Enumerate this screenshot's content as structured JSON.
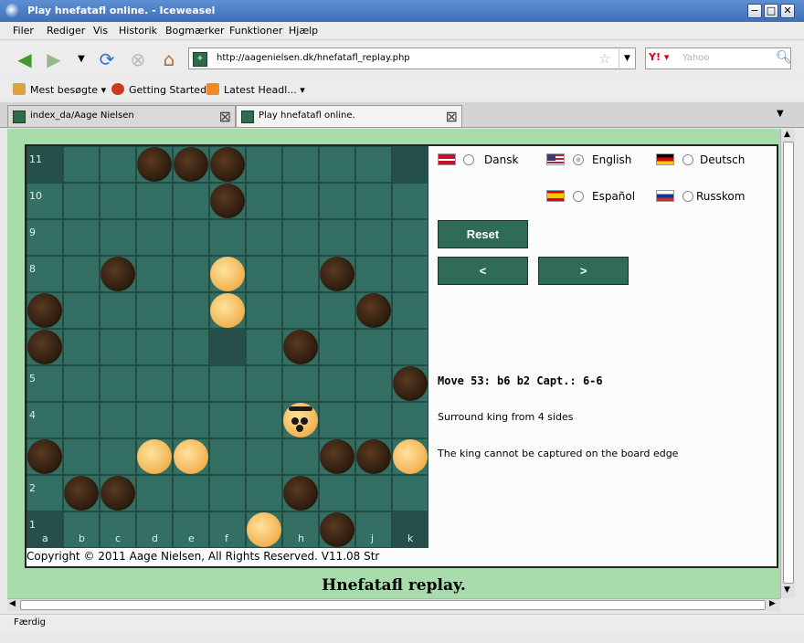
{
  "window": {
    "title": "Play hnefatafl online. - Iceweasel",
    "controls": [
      "−",
      "□",
      "✕"
    ]
  },
  "menu": [
    "Filer",
    "Rediger",
    "Vis",
    "Historik",
    "Bogmærker",
    "Funktioner",
    "Hjælp"
  ],
  "nav": {
    "url": "http://aagenielsen.dk/hnefatafl_replay.php",
    "search_placeholder": "Yahoo",
    "search_engine": "Y!"
  },
  "bookmarks": [
    {
      "label": "Mest besøgte ▾",
      "icon": "folder-icon",
      "color": "#d9a440"
    },
    {
      "label": "Getting Started",
      "icon": "firefox-icon",
      "color": "#cc3a1c"
    },
    {
      "label": "Latest Headl... ▾",
      "icon": "rss-icon",
      "color": "#f08a24"
    }
  ],
  "tabs": [
    {
      "label": "index_da/Aage Nielsen",
      "active": false
    },
    {
      "label": "Play hnefatafl online.",
      "active": true
    }
  ],
  "board": {
    "size": 11,
    "files": [
      "a",
      "b",
      "c",
      "d",
      "e",
      "f",
      "g",
      "h",
      "i",
      "j",
      "k"
    ],
    "ranks": [
      "11",
      "10",
      "9",
      "8",
      "7",
      "6",
      "5",
      "4",
      "3",
      "2",
      "1"
    ],
    "special_squares": [
      [
        0,
        0
      ],
      [
        0,
        10
      ],
      [
        5,
        5
      ],
      [
        10,
        0
      ],
      [
        10,
        10
      ]
    ],
    "black_pieces": [
      [
        0,
        3
      ],
      [
        0,
        4
      ],
      [
        0,
        5
      ],
      [
        1,
        5
      ],
      [
        3,
        2
      ],
      [
        3,
        8
      ],
      [
        4,
        0
      ],
      [
        4,
        9
      ],
      [
        5,
        7
      ],
      [
        5,
        0
      ],
      [
        6,
        10
      ],
      [
        8,
        0
      ],
      [
        8,
        8
      ],
      [
        8,
        9
      ],
      [
        9,
        1
      ],
      [
        9,
        2
      ],
      [
        9,
        7
      ],
      [
        10,
        8
      ]
    ],
    "white_pieces": [
      [
        3,
        5
      ],
      [
        4,
        5
      ],
      [
        8,
        3
      ],
      [
        8,
        4
      ],
      [
        8,
        10
      ],
      [
        10,
        6
      ]
    ],
    "king": [
      7,
      7
    ]
  },
  "copyright": "Copyright © 2011 Aage Nielsen, All Rights Reserved. V11.08 Str",
  "languages": [
    {
      "label": "Dansk",
      "flag": "dk",
      "checked": false
    },
    {
      "label": "English",
      "flag": "us",
      "checked": true
    },
    {
      "label": "Deutsch",
      "flag": "de",
      "checked": false
    },
    {
      "label": "Español",
      "flag": "es",
      "checked": false
    },
    {
      "label": "Russkom",
      "flag": "ru",
      "checked": false
    }
  ],
  "buttons": {
    "reset": "Reset",
    "prev": "<",
    "next": ">"
  },
  "move_info": {
    "move": "Move 53:  b6 b2   Capt.: 6-6",
    "line1": "Surround king from 4 sides",
    "line2": "The king cannot be captured on the board edge"
  },
  "heading": "Hnefatafl replay.",
  "status": "Færdig"
}
